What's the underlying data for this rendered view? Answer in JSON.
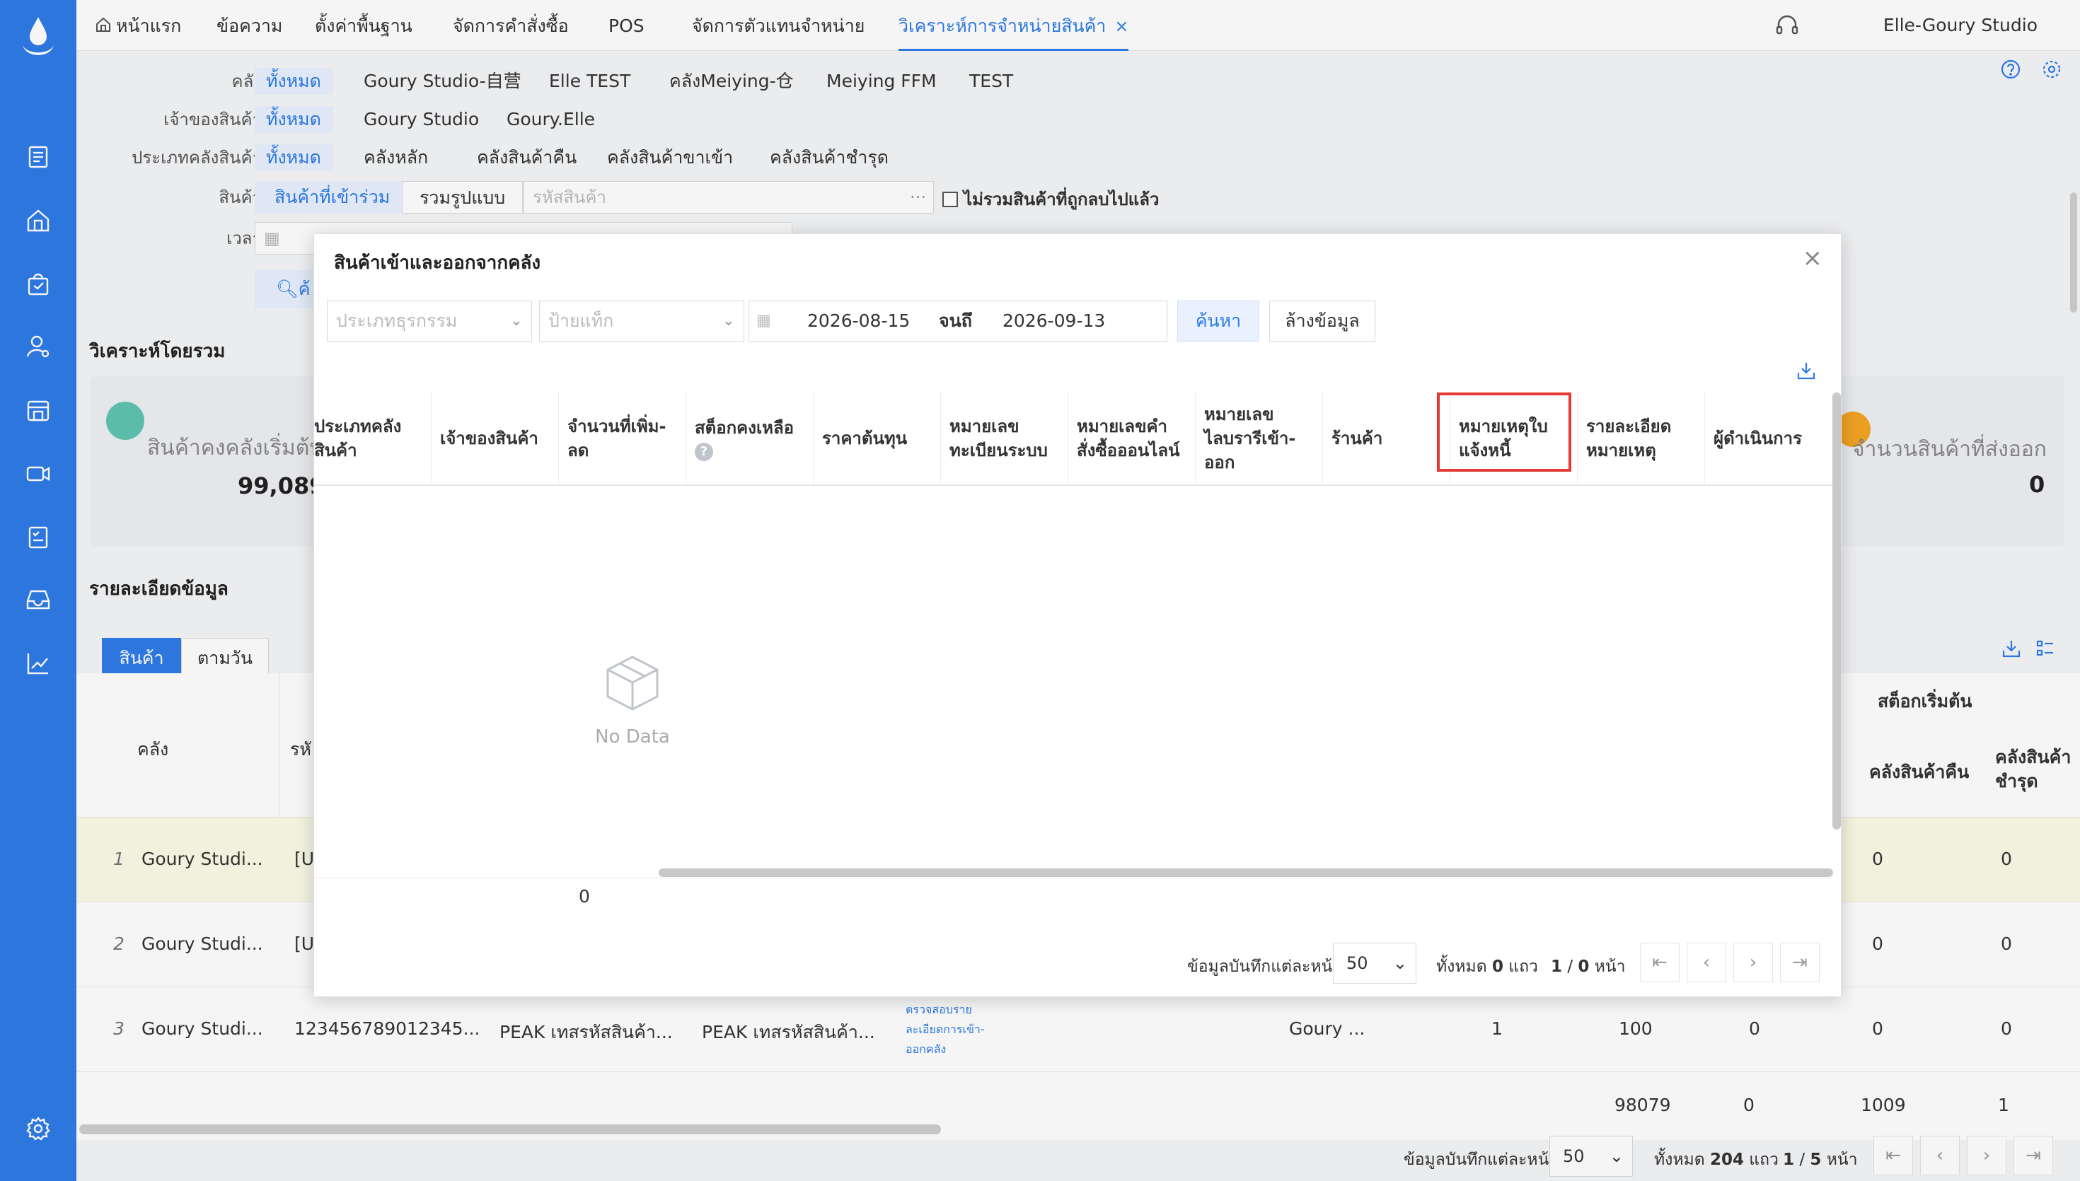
{
  "rail": {
    "icons": [
      "document-icon",
      "home-building-icon",
      "shopping-bag-icon",
      "user-settings-icon",
      "warehouse-icon",
      "video-icon",
      "checklist-icon",
      "inbox-icon",
      "trend-chart-icon"
    ],
    "bottom_icon": "settings-gear-icon"
  },
  "topnav": {
    "tabs": [
      "หน้าแรก",
      "ข้อความ",
      "ตั้งค่าพื้นฐาน",
      "จัดการคำสั่งซื้อ",
      "POS",
      "จัดการตัวแทนจำหน่าย",
      "วิเคราะห์การจำหน่ายสินค้า"
    ],
    "active_tab_close": "×",
    "user": "Elle-Goury Studio"
  },
  "filters": {
    "warehouse": {
      "label": "คลัง",
      "options": [
        "ทั้งหมด",
        "Goury Studio-自营",
        "Elle TEST",
        "คลังMeiying-仓",
        "Meiying FFM",
        "TEST"
      ]
    },
    "owner": {
      "label": "เจ้าของสินค้า",
      "options": [
        "ทั้งหมด",
        "Goury Studio",
        "Goury.Elle"
      ]
    },
    "warehouse_type": {
      "label": "ประเภทคลังสินค้า",
      "options": [
        "ทั้งหมด",
        "คลังหลัก",
        "คลังสินค้าคืน",
        "คลังสินค้าขาเข้า",
        "คลังสินค้าชำรุด"
      ]
    },
    "product": {
      "label": "สินค้า",
      "options": [
        "สินค้าที่เข้าร่วม",
        "รวมรูปแบบ"
      ],
      "placeholder": "รหัสสินค้า",
      "exclude_deleted": "ไม่รวมสินค้าที่ถูกลบไปแล้ว"
    },
    "time": {
      "label": "เวลา"
    },
    "search_label": "ค้"
  },
  "summary": {
    "title": "วิเคราะห์โดยรวม",
    "left_label": "สินค้าคงคลังเริ่มต้น",
    "left_value": "99,089",
    "right_label": "จำนวนสินค้าที่ส่งออก",
    "right_value": "0"
  },
  "detail": {
    "title": "รายละเอียดข้อมูล",
    "tabs": [
      "สินค้า",
      "ตามวัน"
    ],
    "col_warehouse": "คลัง",
    "col_code_cut": "รหั",
    "group_header": "สต็อกเริ่มต้น",
    "col_return": "คลังสินค้าคืน",
    "col_damaged": "คลังสินค้าชำรุด",
    "rows": [
      {
        "no": "1",
        "warehouse": "Goury Studi...",
        "code": "[U",
        "return": "0",
        "damaged": "0"
      },
      {
        "no": "2",
        "warehouse": "Goury Studi...",
        "code": "[U",
        "return": "0",
        "damaged": "0"
      },
      {
        "no": "3",
        "warehouse": "Goury Studi...",
        "code": "123456789012345...",
        "name1": "PEAK เทสรหัสสินค้า...",
        "name2": "PEAK เทสรหัสสินค้า...",
        "link": "ตรวจสอบรายละเอียดการเข้า-ออกคลัง",
        "shop": "Goury ...",
        "v1": "1",
        "v2": "100",
        "v3": "0",
        "return": "0",
        "damaged": "0"
      }
    ],
    "totals": [
      "98079",
      "0",
      "1009",
      "1"
    ],
    "pager": {
      "per_page_label": "ข้อมูลบันทึกแต่ละหน้า",
      "per_page": "50",
      "total_prefix": "ทั้งหมด",
      "total": "204",
      "total_unit": "แถว",
      "page": "1",
      "pages": "5",
      "page_unit": "หน้า"
    }
  },
  "modal": {
    "title": "สินค้าเข้าและออกจากคลัง",
    "close": "×",
    "txn_type_placeholder": "ประเภทธุรกรรม",
    "tag_placeholder": "ป้ายแท็ก",
    "date_from": "2026-08-15",
    "date_to_label": "จนถึ",
    "date_to": "2026-09-13",
    "search_btn": "ค้นหา",
    "clear_btn": "ล้างข้อมูล",
    "columns": [
      [
        "ประเภทคลัง",
        "สินค้า"
      ],
      [
        "เจ้าของสินค้า"
      ],
      [
        "จำนวนที่เพิ่ม-",
        "ลด"
      ],
      [
        "สต็อกคงเหลือ"
      ],
      [
        "ราคาต้นทุน"
      ],
      [
        "หมายเลข",
        "ทะเบียนระบบ"
      ],
      [
        "หมายเลขคำ",
        "สั่งซื้อออนไลน์"
      ],
      [
        "หมายเลข",
        "ไลบรารีเข้า-",
        "ออก"
      ],
      [
        "ร้านค้า"
      ],
      [
        "หมายเหตุใบ",
        "แจ้งหนี้"
      ],
      [
        "รายละเอียด",
        "หมายเหตุ"
      ],
      [
        "ผู้ดำเนินการ"
      ]
    ],
    "help_mark": "?",
    "no_data": "No Data",
    "footer_sum": "0",
    "pager": {
      "per_page_label": "ข้อมูลบันทึกแต่ละหน้า",
      "per_page": "50",
      "total_prefix": "ทั้งหมด",
      "total": "0",
      "total_unit": "แถว",
      "page": "1",
      "pages": "0",
      "page_unit": "หน้า"
    }
  }
}
